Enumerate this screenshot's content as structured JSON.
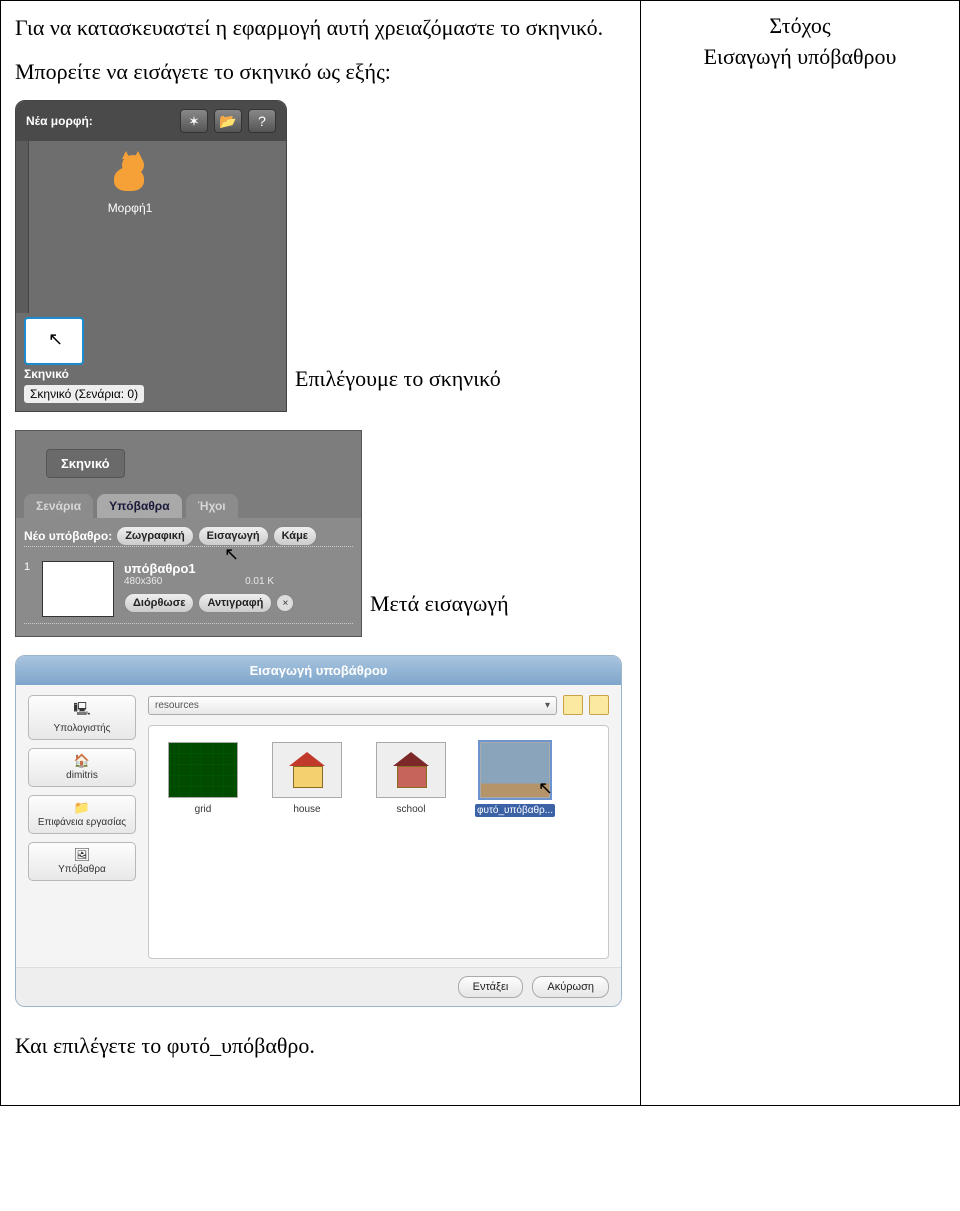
{
  "left": {
    "intro1": "Για να κατασκευαστεί η εφαρμογή αυτή χρειαζόμαστε το σκηνικό.",
    "intro2": "Μπορείτε να εισάγετε το σκηνικό ως εξής:",
    "caption1": "Επιλέγουμε το σκηνικό",
    "caption2": "Μετά εισαγωγή",
    "outro": "Και επιλέγετε το φυτό_υπόβαθρο."
  },
  "right": {
    "goal_label": "Στόχος",
    "goal_text": "Εισαγωγή υπόβαθρου"
  },
  "panel1": {
    "new_sprite": "Νέα μορφή:",
    "sprite_name": "Μορφή1",
    "icon_star": "✶",
    "icon_folder": "📂",
    "icon_q": "?",
    "stage_label": "Σκηνικό",
    "stage_info": "Σκηνικό (Σενάρια: 0)"
  },
  "panel2": {
    "title": "Σκηνικό",
    "tabs": {
      "scripts": "Σενάρια",
      "backgrounds": "Υπόβαθρα",
      "sounds": "Ήχοι"
    },
    "newbg_label": "Νέο υπόβαθρο:",
    "btn_paint": "Ζωγραφική",
    "btn_import": "Εισαγωγή",
    "btn_camera": "Κάμε",
    "bg_number": "1",
    "bg_name": "υπόβαθρο1",
    "bg_dim": "480x360",
    "bg_size": "0.01 K",
    "btn_edit": "Διόρθωσε",
    "btn_copy": "Αντιγραφή",
    "close_x": "×"
  },
  "dialog": {
    "title": "Εισαγωγή υποβάθρου",
    "side": {
      "computer": "Υπολογιστής",
      "user": "dimitris",
      "desktop": "Επιφάνεια εργασίας",
      "backgrounds": "Υπόβαθρα"
    },
    "side_icons": {
      "computer": "🖳",
      "user": "🏠",
      "desktop": "📁",
      "backgrounds": "🖼"
    },
    "path": "resources",
    "path_arrow": "▾",
    "files": {
      "grid": "grid",
      "house": "house",
      "school": "school",
      "plant": "φυτό_υπόβαθρ..."
    },
    "ok": "Εντάξει",
    "cancel": "Ακύρωση"
  }
}
